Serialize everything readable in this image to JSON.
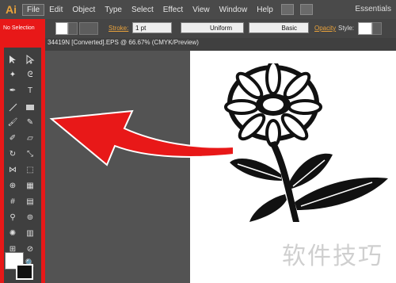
{
  "app": {
    "logo": "Ai",
    "workspace": "Essentials"
  },
  "menu": [
    "File",
    "Edit",
    "Object",
    "Type",
    "Select",
    "Effect",
    "View",
    "Window",
    "Help"
  ],
  "control": {
    "selection_status": "No Selection",
    "stroke_label": "Stroke:",
    "stroke_weight": "1 pt",
    "profile": "Uniform",
    "brush": "Basic",
    "opacity_label": "Opacity",
    "style_label": "Style:"
  },
  "document": {
    "tab_title": "34419N [Converted].EPS @ 66.67% (CMYK/Preview)"
  },
  "watermark": "软件技巧",
  "colors": {
    "highlight": "#e81818",
    "accent": "#e8a23c"
  }
}
